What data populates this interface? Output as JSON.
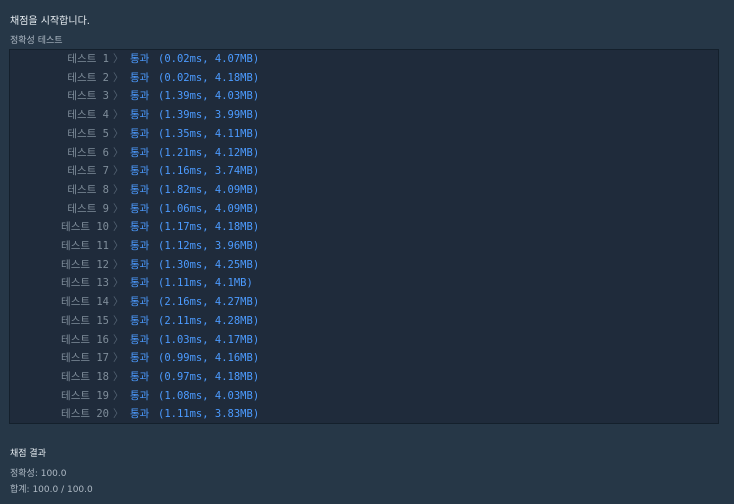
{
  "header": {
    "message": "채점을 시작합니다."
  },
  "accuracy_test": {
    "title": "정확성  테스트",
    "separator": "〉",
    "tests": [
      {
        "name": "테스트 1",
        "status": "통과",
        "detail": "(0.02ms, 4.07MB)"
      },
      {
        "name": "테스트 2",
        "status": "통과",
        "detail": "(0.02ms, 4.18MB)"
      },
      {
        "name": "테스트 3",
        "status": "통과",
        "detail": "(1.39ms, 4.03MB)"
      },
      {
        "name": "테스트 4",
        "status": "통과",
        "detail": "(1.39ms, 3.99MB)"
      },
      {
        "name": "테스트 5",
        "status": "통과",
        "detail": "(1.35ms, 4.11MB)"
      },
      {
        "name": "테스트 6",
        "status": "통과",
        "detail": "(1.21ms, 4.12MB)"
      },
      {
        "name": "테스트 7",
        "status": "통과",
        "detail": "(1.16ms, 3.74MB)"
      },
      {
        "name": "테스트 8",
        "status": "통과",
        "detail": "(1.82ms, 4.09MB)"
      },
      {
        "name": "테스트 9",
        "status": "통과",
        "detail": "(1.06ms, 4.09MB)"
      },
      {
        "name": "테스트 10",
        "status": "통과",
        "detail": "(1.17ms, 4.18MB)"
      },
      {
        "name": "테스트 11",
        "status": "통과",
        "detail": "(1.12ms, 3.96MB)"
      },
      {
        "name": "테스트 12",
        "status": "통과",
        "detail": "(1.30ms, 4.25MB)"
      },
      {
        "name": "테스트 13",
        "status": "통과",
        "detail": "(1.11ms, 4.1MB)"
      },
      {
        "name": "테스트 14",
        "status": "통과",
        "detail": "(2.16ms, 4.27MB)"
      },
      {
        "name": "테스트 15",
        "status": "통과",
        "detail": "(2.11ms, 4.28MB)"
      },
      {
        "name": "테스트 16",
        "status": "통과",
        "detail": "(1.03ms, 4.17MB)"
      },
      {
        "name": "테스트 17",
        "status": "통과",
        "detail": "(0.99ms, 4.16MB)"
      },
      {
        "name": "테스트 18",
        "status": "통과",
        "detail": "(0.97ms, 4.18MB)"
      },
      {
        "name": "테스트 19",
        "status": "통과",
        "detail": "(1.08ms, 4.03MB)"
      },
      {
        "name": "테스트 20",
        "status": "통과",
        "detail": "(1.11ms, 3.83MB)"
      }
    ]
  },
  "summary": {
    "title": "채점 결과",
    "accuracy": "정확성: 100.0",
    "total": "합계: 100.0 / 100.0"
  },
  "colors": {
    "background": "#263747",
    "panel": "#1f2b3b",
    "pass": "#4c9bff",
    "label": "#7f8d9a"
  }
}
